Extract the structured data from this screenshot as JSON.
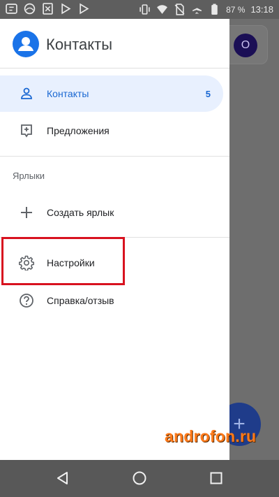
{
  "status_bar": {
    "battery_text": "87 %",
    "time": "13:18",
    "icons": [
      "app-icon",
      "app-icon",
      "app-icon",
      "play-store-icon",
      "play-store-icon",
      "vibrate-icon",
      "wifi-icon",
      "no-sim-icon",
      "airplane-icon",
      "battery-icon"
    ]
  },
  "background": {
    "avatar_letter": "O",
    "fab_symbol": "+"
  },
  "drawer": {
    "title": "Контакты",
    "items": [
      {
        "label": "Контакты",
        "count": "5",
        "icon": "person-icon",
        "selected": true
      },
      {
        "label": "Предложения",
        "icon": "suggestions-icon"
      }
    ],
    "labels_section": "Ярлыки",
    "create_label": "Создать ярлык",
    "settings": "Настройки",
    "help": "Справка/отзыв"
  },
  "watermark": "androfon.ru",
  "colors": {
    "accent": "#1a73e8",
    "selected_bg": "#e8f0fe",
    "highlight": "#d8121f",
    "watermark": "#ff7a1a"
  }
}
